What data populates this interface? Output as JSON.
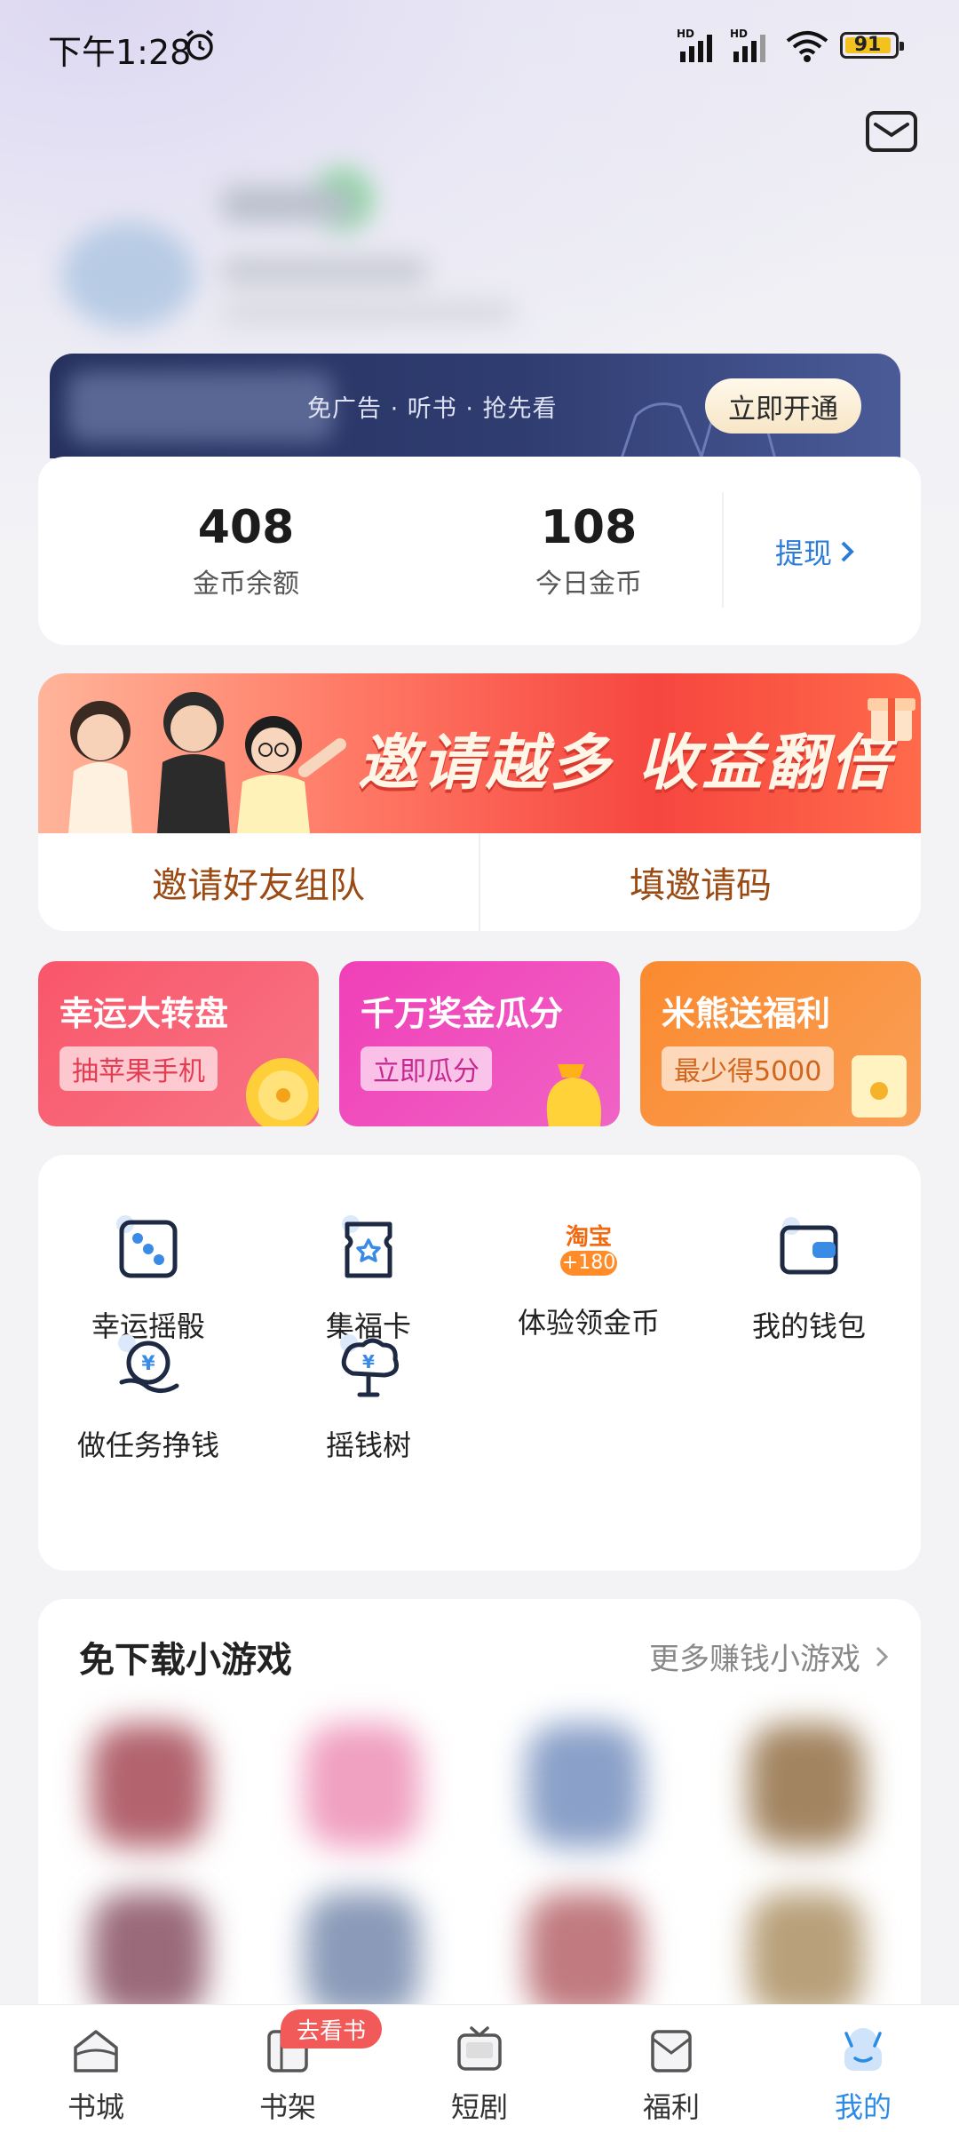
{
  "status_bar": {
    "time": "下午1:28",
    "battery": "91"
  },
  "vip": {
    "text": "免广告 · 听书 · 抢先看",
    "button": "立即开通"
  },
  "coins": {
    "balance_value": "408",
    "balance_label": "金币余额",
    "today_value": "108",
    "today_label": "今日金币",
    "withdraw_label": "提现"
  },
  "invite": {
    "slogan": "邀请越多 收益翻倍",
    "team_button": "邀请好友组队",
    "code_button": "填邀请码"
  },
  "promos": [
    {
      "title": "幸运大转盘",
      "tag": "抽苹果手机",
      "color": "#f9566a"
    },
    {
      "title": "千万奖金瓜分",
      "tag": "立即瓜分",
      "color": "#f03fb8"
    },
    {
      "title": "米熊送福利",
      "tag": "最少得5000",
      "color": "#fb8a2f"
    }
  ],
  "grid": [
    {
      "label": "幸运摇骰",
      "icon": "dice-icon"
    },
    {
      "label": "集福卡",
      "icon": "fortune-card-icon"
    },
    {
      "label": "体验领金币",
      "icon": "taobao-icon",
      "badge_title": "淘宝",
      "badge_value": "+180"
    },
    {
      "label": "我的钱包",
      "icon": "wallet-icon"
    },
    {
      "label": "做任务挣钱",
      "icon": "task-money-icon"
    },
    {
      "label": "摇钱树",
      "icon": "money-tree-icon"
    }
  ],
  "games": {
    "title": "免下载小游戏",
    "more": "更多赚钱小游戏"
  },
  "nav": {
    "items": [
      {
        "label": "书城",
        "icon": "bookstore-icon"
      },
      {
        "label": "书架",
        "icon": "bookshelf-icon"
      },
      {
        "label": "短剧",
        "icon": "short-drama-icon"
      },
      {
        "label": "福利",
        "icon": "welfare-icon"
      },
      {
        "label": "我的",
        "icon": "profile-icon"
      }
    ],
    "badge": "去看书",
    "active_color": "#2b8be6"
  }
}
